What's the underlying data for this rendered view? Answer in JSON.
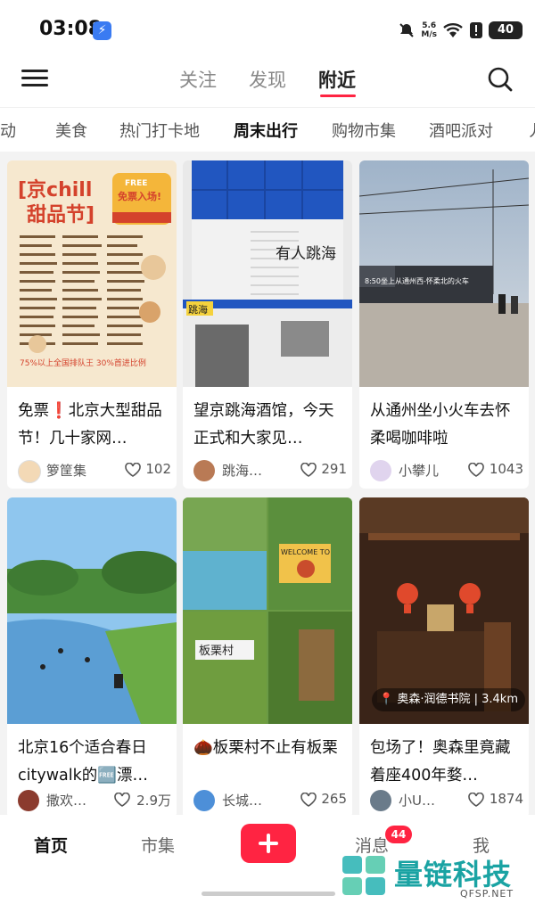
{
  "status": {
    "time": "03:08",
    "net_speed_top": "5.6",
    "net_speed_bottom": "M/s",
    "battery": "40"
  },
  "topnav": {
    "tabs": [
      "关注",
      "发现",
      "附近"
    ],
    "active_tab": "附近"
  },
  "categories": [
    "活动",
    "美食",
    "热门打卡地",
    "周末出行",
    "购物市集",
    "酒吧派对"
  ],
  "cards": [
    {
      "title": "免票❗北京大型甜品节！几十家网…",
      "author": "箩筐集",
      "likes": "102",
      "thumb_text": [
        "京chill",
        "甜品节",
        "免票入场!",
        "FREE",
        "75%以上全国排队王 30%首进比例"
      ]
    },
    {
      "title": "望京跳海酒馆，今天正式和大家见…",
      "author": "跳海…",
      "likes": "291",
      "thumb_text": [
        "有人跳海",
        "跳海"
      ]
    },
    {
      "title": "从通州坐小火车去怀柔喝咖啡啦",
      "author": "小攀儿",
      "likes": "1043",
      "thumb_text": [
        "8:50坐上从通州西-怀柔北的火车"
      ]
    },
    {
      "title": "北京16个适合春日citywalk的🆓漂…",
      "author": "撒欢…",
      "likes": "2.9万"
    },
    {
      "title": "🌰板栗村不止有板栗",
      "author": "长城…",
      "likes": "265",
      "thumb_text": [
        "WELCOME TO",
        "板栗村"
      ]
    },
    {
      "title": "包场了！奥森里竟藏着座400年婺…",
      "author": "小U…",
      "likes": "1874",
      "location": "奥森·润德书院",
      "distance": "3.4km"
    }
  ],
  "bottomnav": {
    "items": [
      "首页",
      "市集",
      "消息",
      "我"
    ],
    "active": "首页",
    "badge": "44"
  },
  "watermark": {
    "text": "量链科技",
    "sub": "QFSP.NET"
  },
  "colors": {
    "accent": "#ff2442",
    "feed_bg": "#f3f3f3"
  }
}
